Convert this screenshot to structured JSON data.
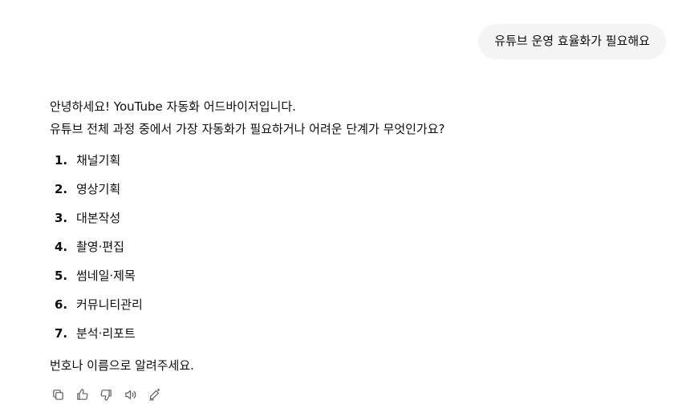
{
  "user_message": "유튜브 운영 효율화가 필요해요",
  "assistant": {
    "greeting": "안녕하세요! YouTube 자동화 어드바이저입니다.",
    "question": "유튜브 전체 과정 중에서 가장 자동화가 필요하거나 어려운 단계가 무엇인가요?",
    "options": [
      {
        "num": "1.",
        "label": "채널기획"
      },
      {
        "num": "2.",
        "label": "영상기획"
      },
      {
        "num": "3.",
        "label": "대본작성"
      },
      {
        "num": "4.",
        "label": "촬영·편집"
      },
      {
        "num": "5.",
        "label": "썸네일·제목"
      },
      {
        "num": "6.",
        "label": "커뮤니티관리"
      },
      {
        "num": "7.",
        "label": "분석·리포트"
      }
    ],
    "outro": "번호나 이름으로 알려주세요."
  },
  "actions": {
    "icons": [
      "copy-icon",
      "thumbs-up-icon",
      "thumbs-down-icon",
      "read-aloud-icon",
      "edit-icon"
    ]
  },
  "colors": {
    "user_bubble_bg": "#f4f4f4",
    "text": "#0d0d0d",
    "icon": "#5d5d5d"
  }
}
